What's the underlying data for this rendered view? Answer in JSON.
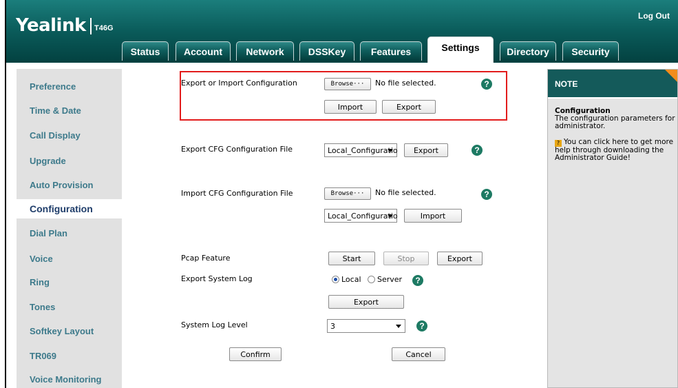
{
  "header": {
    "logo": "Yealink",
    "model": "T46G",
    "logout": "Log Out"
  },
  "tabs": [
    {
      "label": "Status"
    },
    {
      "label": "Account"
    },
    {
      "label": "Network"
    },
    {
      "label": "DSSKey"
    },
    {
      "label": "Features"
    },
    {
      "label": "Settings",
      "active": true
    },
    {
      "label": "Directory"
    },
    {
      "label": "Security"
    }
  ],
  "sidebar": {
    "items": [
      {
        "label": "Preference"
      },
      {
        "label": "Time & Date"
      },
      {
        "label": "Call Display"
      },
      {
        "label": "Upgrade"
      },
      {
        "label": "Auto Provision"
      },
      {
        "label": "Configuration",
        "active": true
      },
      {
        "label": "Dial Plan"
      },
      {
        "label": "Voice"
      },
      {
        "label": "Ring"
      },
      {
        "label": "Tones"
      },
      {
        "label": "Softkey Layout"
      },
      {
        "label": "TR069"
      },
      {
        "label": "Voice Monitoring"
      }
    ]
  },
  "main": {
    "export_import": {
      "label": "Export or Import Configuration",
      "browse": "Browse···",
      "file_status": "No file selected.",
      "import": "Import",
      "export": "Export"
    },
    "export_cfg": {
      "label": "Export CFG Configuration File",
      "select_value": "Local_Configuratio",
      "export": "Export"
    },
    "import_cfg": {
      "label": "Import CFG Configuration File",
      "browse": "Browse···",
      "file_status": "No file selected.",
      "select_value": "Local_Configuratio",
      "import": "Import"
    },
    "pcap": {
      "label": "Pcap Feature",
      "start": "Start",
      "stop": "Stop",
      "export": "Export"
    },
    "system_log": {
      "label": "Export System Log",
      "local": "Local",
      "server": "Server",
      "selected": "Local",
      "export": "Export"
    },
    "log_level": {
      "label": "System Log Level",
      "value": "3"
    },
    "confirm": "Confirm",
    "cancel": "Cancel"
  },
  "note": {
    "title": "NOTE",
    "heading": "Configuration",
    "text": "The configuration parameters for administrator.",
    "help_text": "You can click here to get more help through downloading the Administrator Guide!"
  },
  "colors": {
    "header_teal": "#0a5b5a",
    "highlight_red": "#e21b1b",
    "sidebar_link": "#3d7a8b",
    "note_corner": "#f28c1c",
    "help_green": "#1d7a63"
  }
}
